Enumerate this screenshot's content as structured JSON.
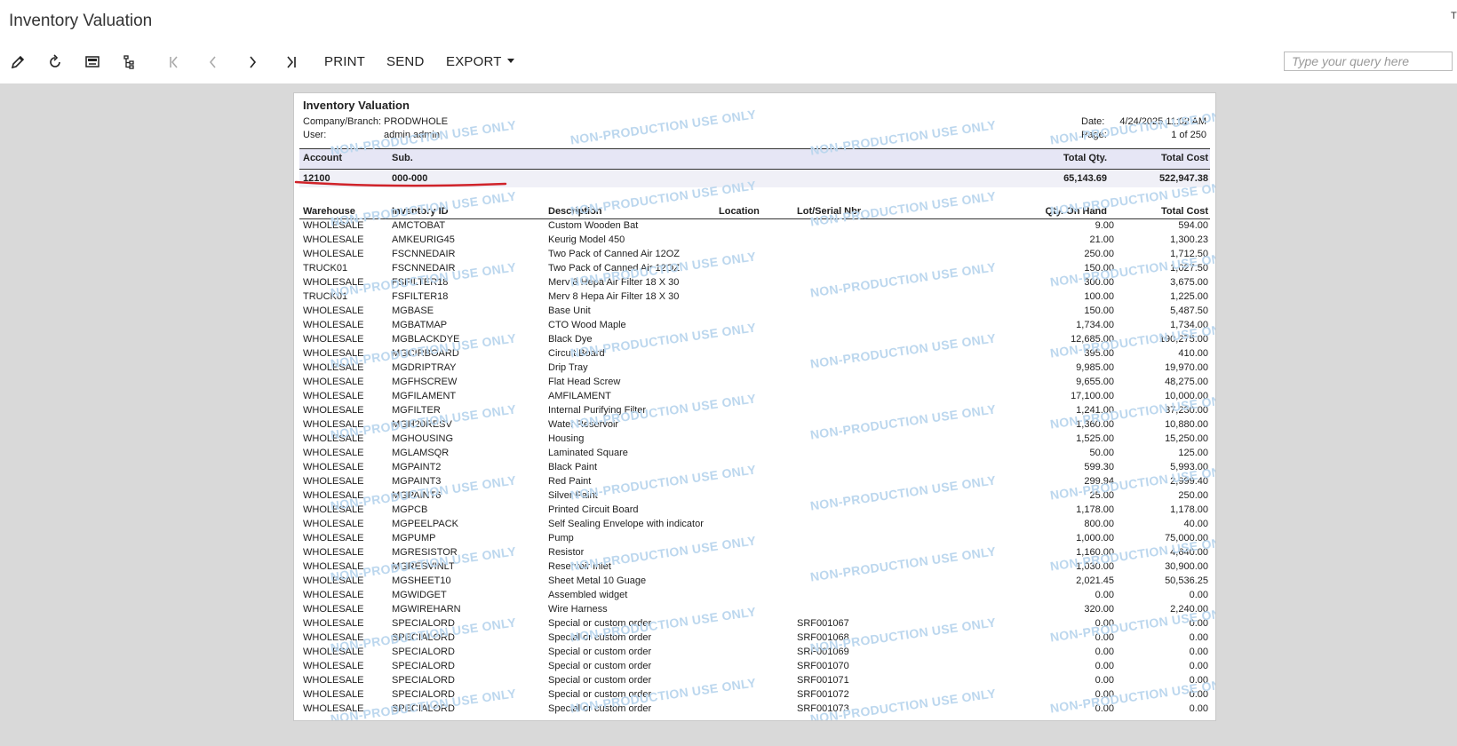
{
  "app": {
    "title": "Inventory Valuation",
    "corner_text": "T"
  },
  "toolbar": {
    "icons": [
      "pencil-icon",
      "refresh-icon",
      "keyboard-icon",
      "tree-icon",
      "first-page-icon",
      "prev-page-icon",
      "next-page-icon",
      "last-page-icon"
    ],
    "print_label": "PRINT",
    "send_label": "SEND",
    "export_label": "EXPORT",
    "search_placeholder": "Type your query here"
  },
  "report": {
    "title": "Inventory Valuation",
    "company_label": "Company/Branch:",
    "company_value": "PRODWHOLE",
    "user_label": "User:",
    "user_value": "admin admin",
    "date_label": "Date:",
    "date_value": "4/24/2025 11:02 AM",
    "page_label": "Page:",
    "page_value": "1 of 250",
    "group_headers": {
      "account": "Account",
      "sub": "Sub.",
      "total_qty": "Total Qty.",
      "total_cost": "Total Cost"
    },
    "group": {
      "account": "12100",
      "sub": "000-000",
      "total_qty": "65,143.69",
      "total_cost": "522,947.38"
    },
    "columns": {
      "warehouse": "Warehouse",
      "inventory_id": "Inventory ID",
      "description": "Description",
      "location": "Location",
      "lot": "Lot/Serial Nbr.",
      "qty": "Qty. On Hand",
      "cost": "Total Cost"
    },
    "watermark_text": "NON-PRODUCTION USE ONLY",
    "rows": [
      [
        "WHOLESALE",
        "AMCTOBAT",
        "Custom Wooden Bat",
        "",
        "",
        "9.00",
        "594.00"
      ],
      [
        "WHOLESALE",
        "AMKEURIG45",
        "Keurig Model 450",
        "",
        "",
        "21.00",
        "1,300.23"
      ],
      [
        "WHOLESALE",
        "FSCNNEDAIR",
        "Two Pack of Canned Air 12OZ",
        "",
        "",
        "250.00",
        "1,712.50"
      ],
      [
        "TRUCK01",
        "FSCNNEDAIR",
        "Two Pack of Canned Air 12OZ",
        "",
        "",
        "150.00",
        "1,027.50"
      ],
      [
        "WHOLESALE",
        "FSFILTER18",
        "Merv 8 Hepa Air Filter 18 X 30",
        "",
        "",
        "300.00",
        "3,675.00"
      ],
      [
        "TRUCK01",
        "FSFILTER18",
        "Merv 8 Hepa Air Filter 18 X 30",
        "",
        "",
        "100.00",
        "1,225.00"
      ],
      [
        "WHOLESALE",
        "MGBASE",
        "Base Unit",
        "",
        "",
        "150.00",
        "5,487.50"
      ],
      [
        "WHOLESALE",
        "MGBATMAP",
        "CTO Wood Maple",
        "",
        "",
        "1,734.00",
        "1,734.00"
      ],
      [
        "WHOLESALE",
        "MGBLACKDYE",
        "Black Dye",
        "",
        "",
        "12,685.00",
        "190,275.00"
      ],
      [
        "WHOLESALE",
        "MGCIRBOARD",
        "Circuit Board",
        "",
        "",
        "395.00",
        "410.00"
      ],
      [
        "WHOLESALE",
        "MGDRIPTRAY",
        "Drip Tray",
        "",
        "",
        "9,985.00",
        "19,970.00"
      ],
      [
        "WHOLESALE",
        "MGFHSCREW",
        "Flat Head Screw",
        "",
        "",
        "9,655.00",
        "48,275.00"
      ],
      [
        "WHOLESALE",
        "MGFILAMENT",
        "AMFILAMENT",
        "",
        "",
        "17,100.00",
        "10,000.00"
      ],
      [
        "WHOLESALE",
        "MGFILTER",
        "Internal Purifying Filter",
        "",
        "",
        "1,241.00",
        "37,230.00"
      ],
      [
        "WHOLESALE",
        "MGH20RESV",
        "Water Reservoir",
        "",
        "",
        "1,360.00",
        "10,880.00"
      ],
      [
        "WHOLESALE",
        "MGHOUSING",
        "Housing",
        "",
        "",
        "1,525.00",
        "15,250.00"
      ],
      [
        "WHOLESALE",
        "MGLAMSQR",
        "Laminated Square",
        "",
        "",
        "50.00",
        "125.00"
      ],
      [
        "WHOLESALE",
        "MGPAINT2",
        "Black Paint",
        "",
        "",
        "599.30",
        "5,993.00"
      ],
      [
        "WHOLESALE",
        "MGPAINT3",
        "Red Paint",
        "",
        "",
        "299.94",
        "2,999.40"
      ],
      [
        "WHOLESALE",
        "MGPAINT6",
        "Silver Paint",
        "",
        "",
        "25.00",
        "250.00"
      ],
      [
        "WHOLESALE",
        "MGPCB",
        "Printed Circuit Board",
        "",
        "",
        "1,178.00",
        "1,178.00"
      ],
      [
        "WHOLESALE",
        "MGPEELPACK",
        "Self Sealing Envelope with indicator",
        "",
        "",
        "800.00",
        "40.00"
      ],
      [
        "WHOLESALE",
        "MGPUMP",
        "Pump",
        "",
        "",
        "1,000.00",
        "75,000.00"
      ],
      [
        "WHOLESALE",
        "MGRESISTOR",
        "Resistor",
        "",
        "",
        "1,160.00",
        "4,640.00"
      ],
      [
        "WHOLESALE",
        "MGRESVINLT",
        "Reservoir Inlet",
        "",
        "",
        "1,030.00",
        "30,900.00"
      ],
      [
        "WHOLESALE",
        "MGSHEET10",
        "Sheet Metal 10 Guage",
        "",
        "",
        "2,021.45",
        "50,536.25"
      ],
      [
        "WHOLESALE",
        "MGWIDGET",
        "Assembled widget",
        "",
        "",
        "0.00",
        "0.00"
      ],
      [
        "WHOLESALE",
        "MGWIREHARN",
        "Wire Harness",
        "",
        "",
        "320.00",
        "2,240.00"
      ],
      [
        "WHOLESALE",
        "SPECIALORD",
        "Special or custom order",
        "",
        "SRF001067",
        "0.00",
        "0.00"
      ],
      [
        "WHOLESALE",
        "SPECIALORD",
        "Special or custom order",
        "",
        "SRF001068",
        "0.00",
        "0.00"
      ],
      [
        "WHOLESALE",
        "SPECIALORD",
        "Special or custom order",
        "",
        "SRF001069",
        "0.00",
        "0.00"
      ],
      [
        "WHOLESALE",
        "SPECIALORD",
        "Special or custom order",
        "",
        "SRF001070",
        "0.00",
        "0.00"
      ],
      [
        "WHOLESALE",
        "SPECIALORD",
        "Special or custom order",
        "",
        "SRF001071",
        "0.00",
        "0.00"
      ],
      [
        "WHOLESALE",
        "SPECIALORD",
        "Special or custom order",
        "",
        "SRF001072",
        "0.00",
        "0.00"
      ],
      [
        "WHOLESALE",
        "SPECIALORD",
        "Special or custom order",
        "",
        "SRF001073",
        "0.00",
        "0.00"
      ]
    ]
  },
  "colors": {
    "band": "#e6e6f5",
    "watermark": "#bcd7ee",
    "annotation": "#d0232a"
  }
}
